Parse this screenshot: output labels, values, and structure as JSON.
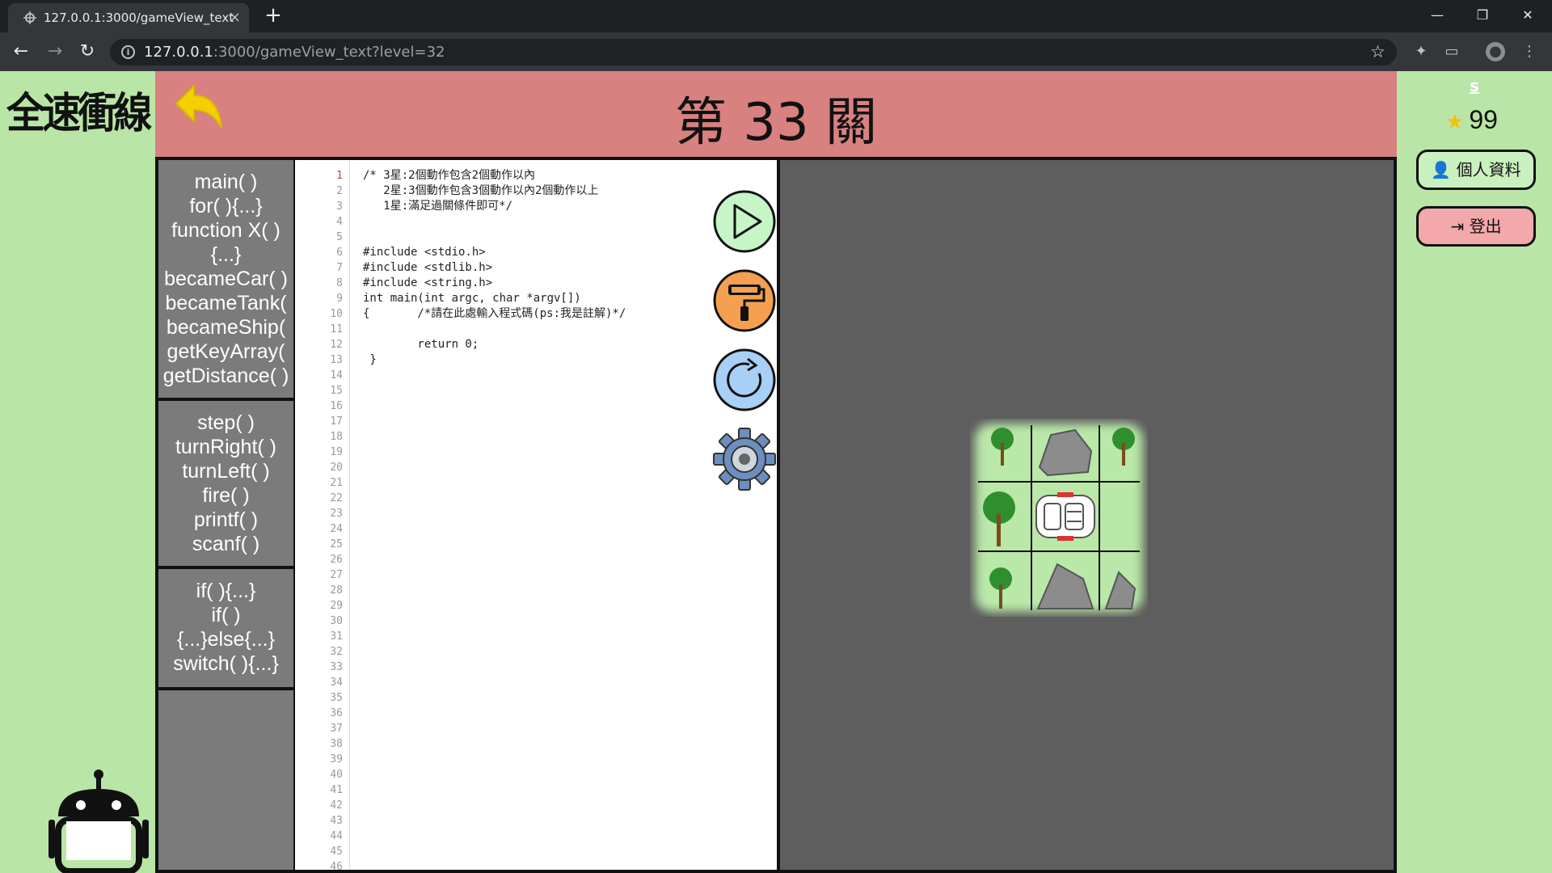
{
  "browser": {
    "tab_title": "127.0.0.1:3000/gameView_text",
    "close_icon": "×",
    "new_tab": "+",
    "address_host": "127.0.0.1",
    "address_path": ":3000/gameView_text?level=32",
    "window_buttons": [
      "—",
      "❐",
      "✕"
    ]
  },
  "app": {
    "logo_text": "全速衝線",
    "level_title": "第 33 關",
    "user": {
      "name": "s",
      "stars": "99"
    },
    "buttons": {
      "profile": "個人資料",
      "logout": "登出"
    }
  },
  "palette": {
    "group1": [
      "main( )",
      "for( ){...}",
      "function X( )",
      "{...}",
      "becameCar( )",
      "becameTank(",
      "becameShip(",
      "getKeyArray(",
      "getDistance( )"
    ],
    "group2": [
      "step( )",
      "turnRight( )",
      "turnLeft( )",
      "fire( )",
      "printf( )",
      "scanf( )"
    ],
    "group3": [
      "if( ){...}",
      "if( )",
      "{...}else{...}",
      "switch( ){...}"
    ]
  },
  "editor": {
    "line_count": 46,
    "active_line": 1,
    "code": "/* 3星:2個動作包含2個動作以內\n   2星:3個動作包含3個動作以內2個動作以上\n   1星:滿足過關條件即可*/\n\n\n#include <stdio.h>\n#include <stdlib.h>\n#include <string.h>\nint main(int argc, char *argv[])\n{       /*請在此處輸入程式碼(ps:我是註解)*/\n\n        return 0;\n }"
  },
  "tools": [
    "play-icon",
    "paint-roller-icon",
    "reset-icon",
    "settings-gear-icon"
  ],
  "colors": {
    "background": "#b9e6a6",
    "header": "#d98080",
    "palette": "#7b7b7b",
    "stage": "#5e5e5e",
    "play": "#c6f5c6",
    "roller": "#f4a050",
    "reset": "#a8cff5",
    "logout": "#f3a8ac"
  }
}
